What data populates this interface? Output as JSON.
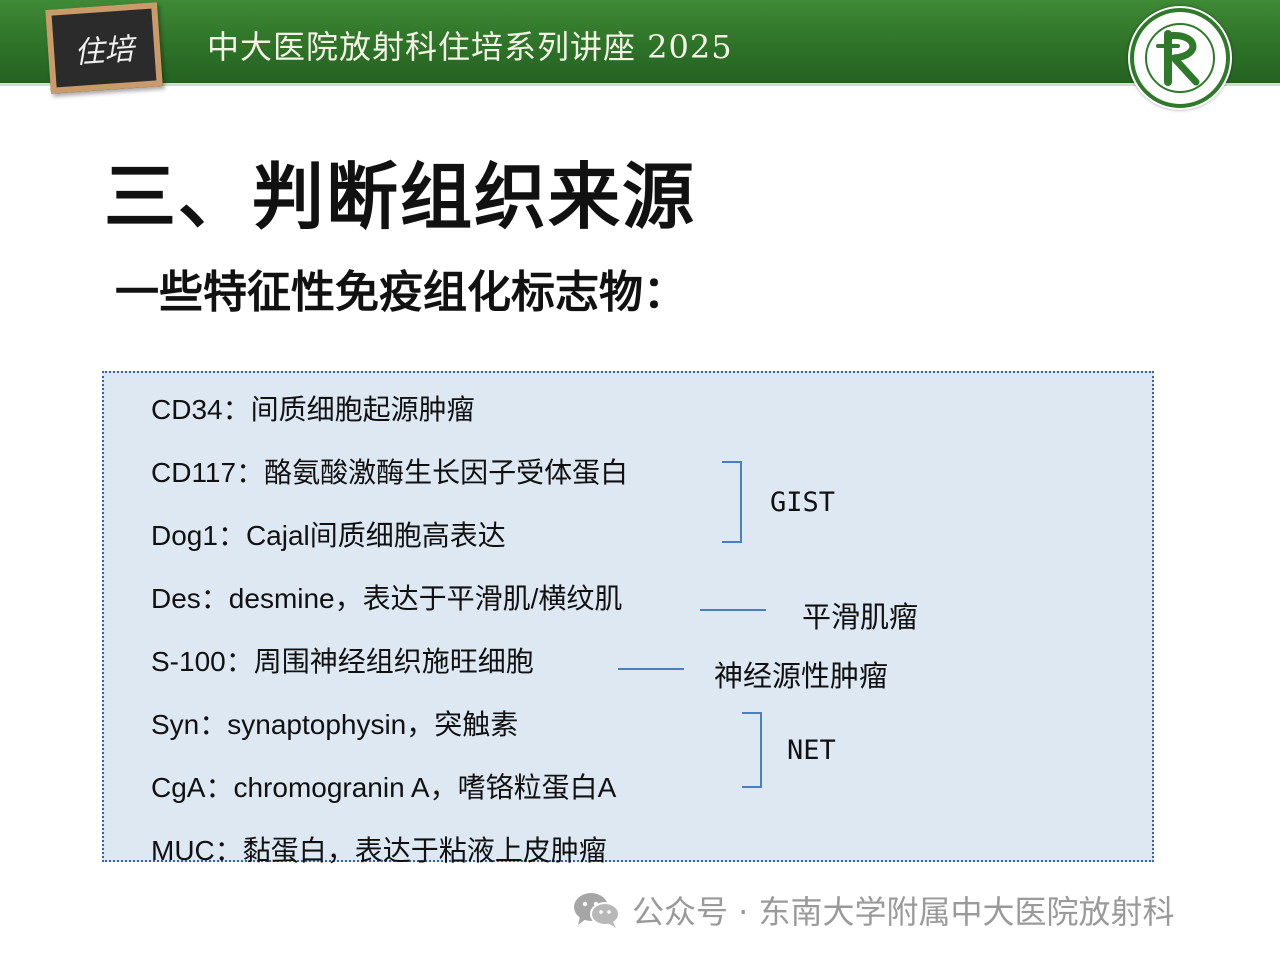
{
  "header": {
    "board_text": "住培",
    "title": "中大医院放射科住培系列讲座 2025",
    "colors": {
      "bar": "#2e7228",
      "logo_ring": "#2f7a2a"
    }
  },
  "slide": {
    "title": "三、判断组织来源",
    "subtitle": "一些特征性免疫组化标志物："
  },
  "markers": [
    "CD34：间质细胞起源肿瘤",
    "CD117：酪氨酸激酶生长因子受体蛋白",
    "Dog1：Cajal间质细胞高表达",
    "Des：desmine，表达于平滑肌/横纹肌",
    "S-100：周围神经组织施旺细胞",
    "Syn：synaptophysin，突触素",
    "CgA：chromogranin A，嗜铬粒蛋白A",
    "MUC：黏蛋白，表达于粘液上皮肿瘤"
  ],
  "groups": {
    "gist": "GIST",
    "smooth_muscle": "平滑肌瘤",
    "neurogenic": "神经源性肿瘤",
    "net": "NET"
  },
  "watermark": {
    "icon": "wechat-icon",
    "text": "公众号 · 东南大学附属中大医院放射科"
  }
}
